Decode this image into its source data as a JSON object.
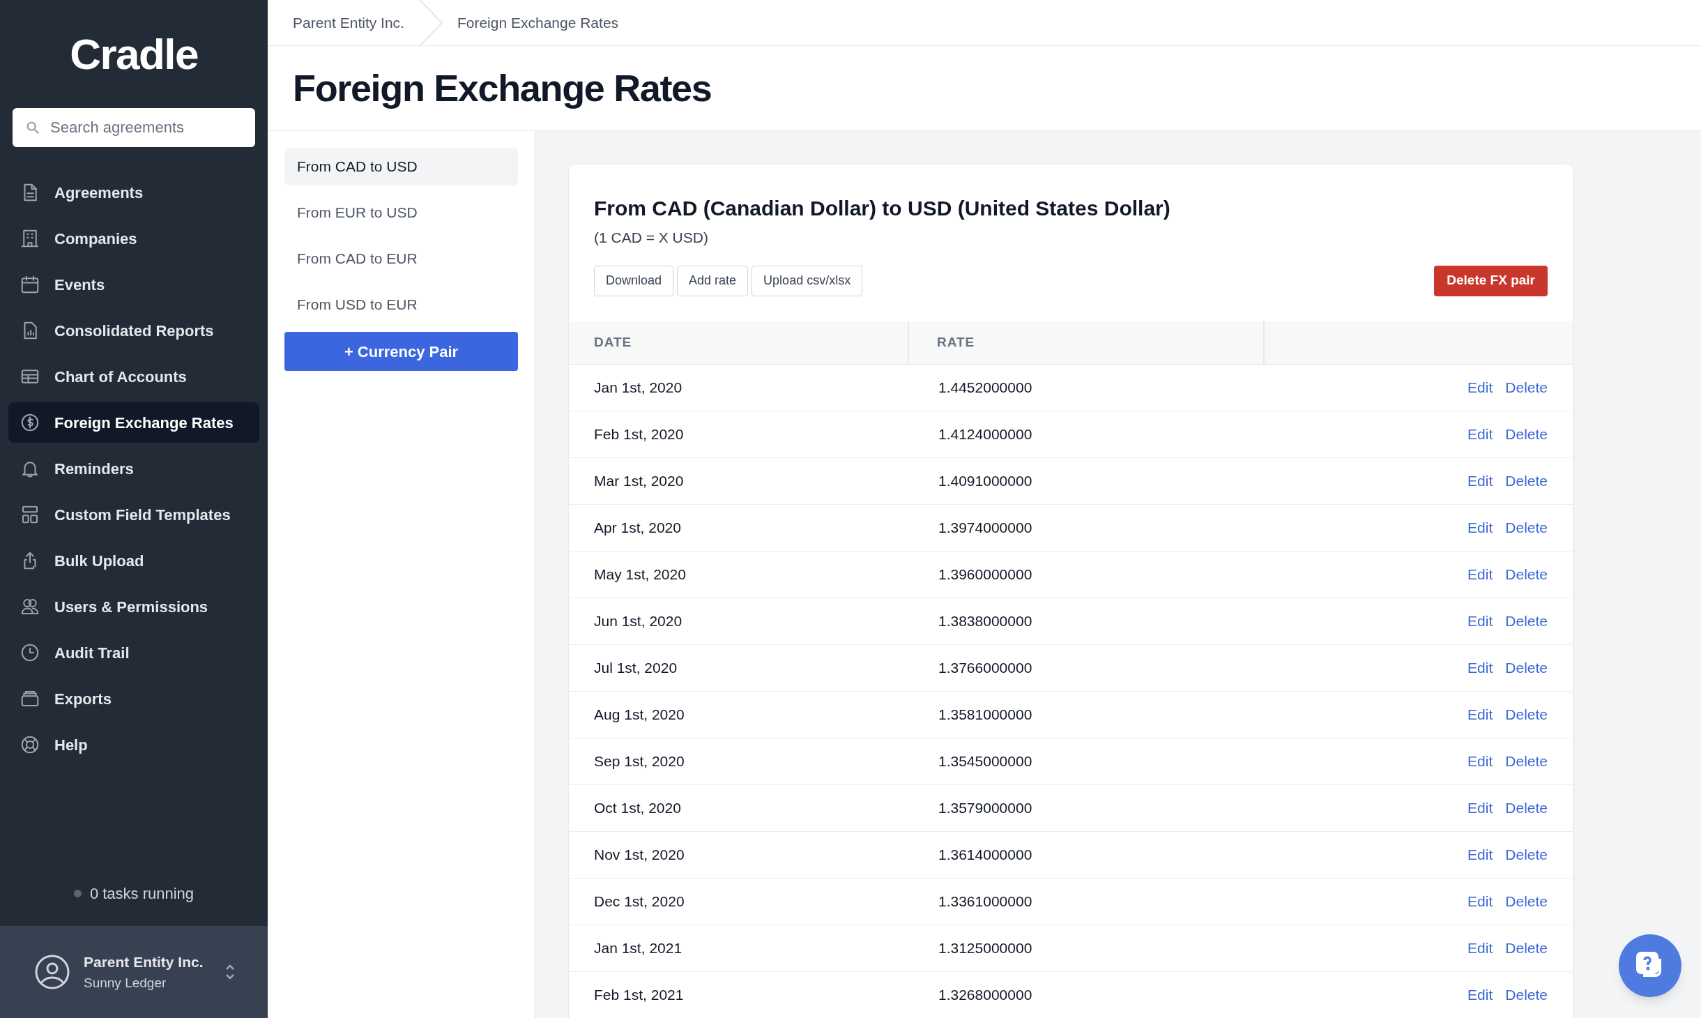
{
  "sidebar": {
    "logo": "Cradle",
    "search": {
      "placeholder": "Search agreements"
    },
    "items": [
      {
        "label": "Agreements",
        "selected": false
      },
      {
        "label": "Companies",
        "selected": false
      },
      {
        "label": "Events",
        "selected": false
      },
      {
        "label": "Consolidated Reports",
        "selected": false
      },
      {
        "label": "Chart of Accounts",
        "selected": false
      },
      {
        "label": "Foreign Exchange Rates",
        "selected": true
      },
      {
        "label": "Reminders",
        "selected": false
      },
      {
        "label": "Custom Field Templates",
        "selected": false
      },
      {
        "label": "Bulk Upload",
        "selected": false
      },
      {
        "label": "Users & Permissions",
        "selected": false
      },
      {
        "label": "Audit Trail",
        "selected": false
      },
      {
        "label": "Exports",
        "selected": false
      },
      {
        "label": "Help",
        "selected": false
      }
    ],
    "tasks": "0 tasks running",
    "account": {
      "name": "Parent Entity Inc.",
      "user": "Sunny Ledger"
    }
  },
  "breadcrumb": [
    "Parent Entity Inc.",
    "Foreign Exchange Rates"
  ],
  "title": "Foreign Exchange Rates",
  "pairs": [
    {
      "label": "From CAD to USD",
      "selected": true
    },
    {
      "label": "From EUR to USD",
      "selected": false
    },
    {
      "label": "From CAD to EUR",
      "selected": false
    },
    {
      "label": "From USD to EUR",
      "selected": false
    }
  ],
  "add_pair": "+ Currency Pair",
  "card": {
    "title": "From CAD (Canadian Dollar) to USD (United States Dollar)",
    "subtitle": "(1 CAD = X USD)",
    "buttons": [
      "Download",
      "Add rate",
      "Upload csv/xlsx"
    ],
    "delete_button": "Delete FX pair",
    "columns": [
      "DATE",
      "RATE"
    ],
    "rows": [
      {
        "date": "Jan 1st, 2020",
        "rate": "1.4452000000",
        "edit": "Edit",
        "delete": "Delete"
      },
      {
        "date": "Feb 1st, 2020",
        "rate": "1.4124000000",
        "edit": "Edit",
        "delete": "Delete"
      },
      {
        "date": "Mar 1st, 2020",
        "rate": "1.4091000000",
        "edit": "Edit",
        "delete": "Delete"
      },
      {
        "date": "Apr 1st, 2020",
        "rate": "1.3974000000",
        "edit": "Edit",
        "delete": "Delete"
      },
      {
        "date": "May 1st, 2020",
        "rate": "1.3960000000",
        "edit": "Edit",
        "delete": "Delete"
      },
      {
        "date": "Jun 1st, 2020",
        "rate": "1.3838000000",
        "edit": "Edit",
        "delete": "Delete"
      },
      {
        "date": "Jul 1st, 2020",
        "rate": "1.3766000000",
        "edit": "Edit",
        "delete": "Delete"
      },
      {
        "date": "Aug 1st, 2020",
        "rate": "1.3581000000",
        "edit": "Edit",
        "delete": "Delete"
      },
      {
        "date": "Sep 1st, 2020",
        "rate": "1.3545000000",
        "edit": "Edit",
        "delete": "Delete"
      },
      {
        "date": "Oct 1st, 2020",
        "rate": "1.3579000000",
        "edit": "Edit",
        "delete": "Delete"
      },
      {
        "date": "Nov 1st, 2020",
        "rate": "1.3614000000",
        "edit": "Edit",
        "delete": "Delete"
      },
      {
        "date": "Dec 1st, 2020",
        "rate": "1.3361000000",
        "edit": "Edit",
        "delete": "Delete"
      },
      {
        "date": "Jan 1st, 2021",
        "rate": "1.3125000000",
        "edit": "Edit",
        "delete": "Delete"
      },
      {
        "date": "Feb 1st, 2021",
        "rate": "1.3268000000",
        "edit": "Edit",
        "delete": "Delete"
      }
    ]
  }
}
